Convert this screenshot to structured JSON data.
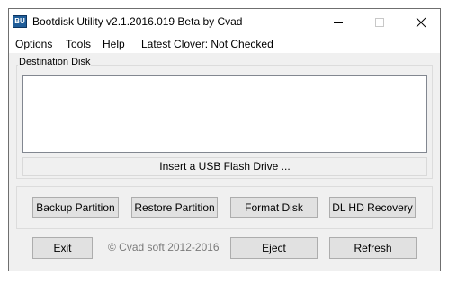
{
  "window": {
    "title": "Bootdisk Utility v2.1.2016.019 Beta by Cvad",
    "icon_text": "BU",
    "controls": [
      "minimize-icon",
      "maximize-icon",
      "close-icon"
    ]
  },
  "menu": {
    "options": "Options",
    "tools": "Tools",
    "help": "Help",
    "clover_status": "Latest Clover: Not Checked"
  },
  "destination": {
    "group_label": "Destination Disk",
    "status": "Insert a USB Flash Drive ..."
  },
  "actions": {
    "backup": "Backup Partition",
    "restore": "Restore Partition",
    "format": "Format Disk",
    "recovery": "DL HD Recovery"
  },
  "footer": {
    "exit": "Exit",
    "copyright": "© Cvad soft 2012-2016",
    "eject": "Eject",
    "refresh": "Refresh"
  }
}
